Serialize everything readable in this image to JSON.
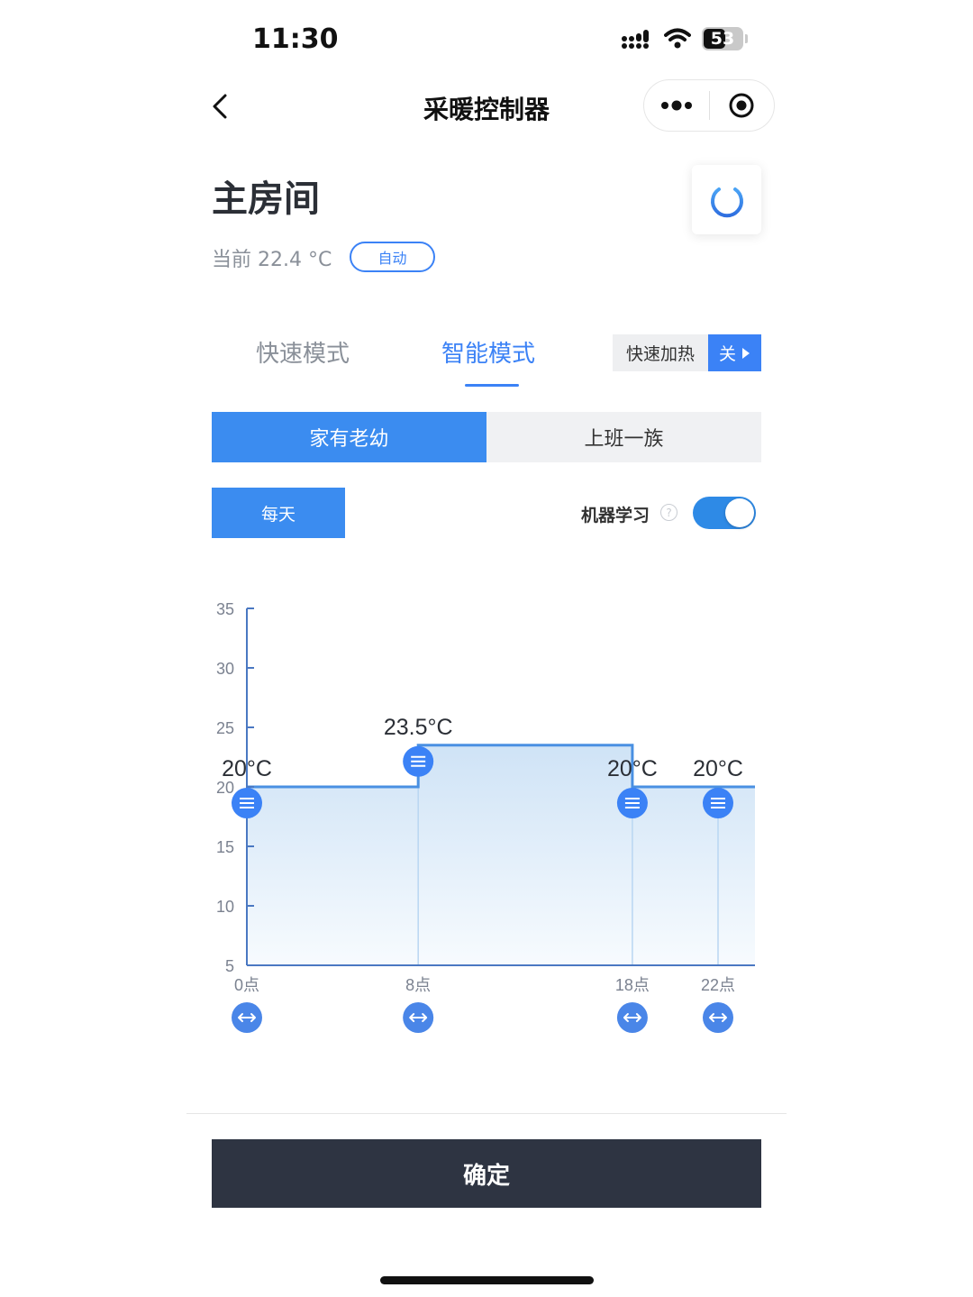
{
  "status_bar": {
    "time": "11:30",
    "battery": "53"
  },
  "nav": {
    "title": "采暖控制器"
  },
  "room": {
    "name": "主房间",
    "current_temp_text": "当前 22.4 °C",
    "mode_badge": "自动"
  },
  "mode_tabs": [
    {
      "label": "快速模式"
    },
    {
      "label": "智能模式"
    }
  ],
  "fast_heat": {
    "label": "快速加热",
    "state": "关"
  },
  "profiles": [
    {
      "label": "家有老幼"
    },
    {
      "label": "上班一族"
    }
  ],
  "schedule": {
    "day_button": "每天",
    "ml_label": "机器学习",
    "ml_enabled": true
  },
  "chart_data": {
    "type": "line",
    "y_ticks": [
      5,
      10,
      15,
      20,
      25,
      30,
      35
    ],
    "ylim": [
      5,
      35
    ],
    "xlim": [
      0,
      24
    ],
    "points": [
      {
        "hour": 0,
        "x_label": "0点",
        "temp": 20,
        "temp_label": "20°C"
      },
      {
        "hour": 8,
        "x_label": "8点",
        "temp": 23.5,
        "temp_label": "23.5°C"
      },
      {
        "hour": 18,
        "x_label": "18点",
        "temp": 20,
        "temp_label": "20°C"
      },
      {
        "hour": 22,
        "x_label": "22点",
        "temp": 20,
        "temp_label": "20°C"
      }
    ],
    "colors": {
      "line": "#4a90e2",
      "fill_top": "#cfe3f6",
      "fill_bottom": "#f7fbfe",
      "handle": "#3b82f6",
      "axis": "#4a78c2"
    }
  },
  "confirm_button": "确定"
}
